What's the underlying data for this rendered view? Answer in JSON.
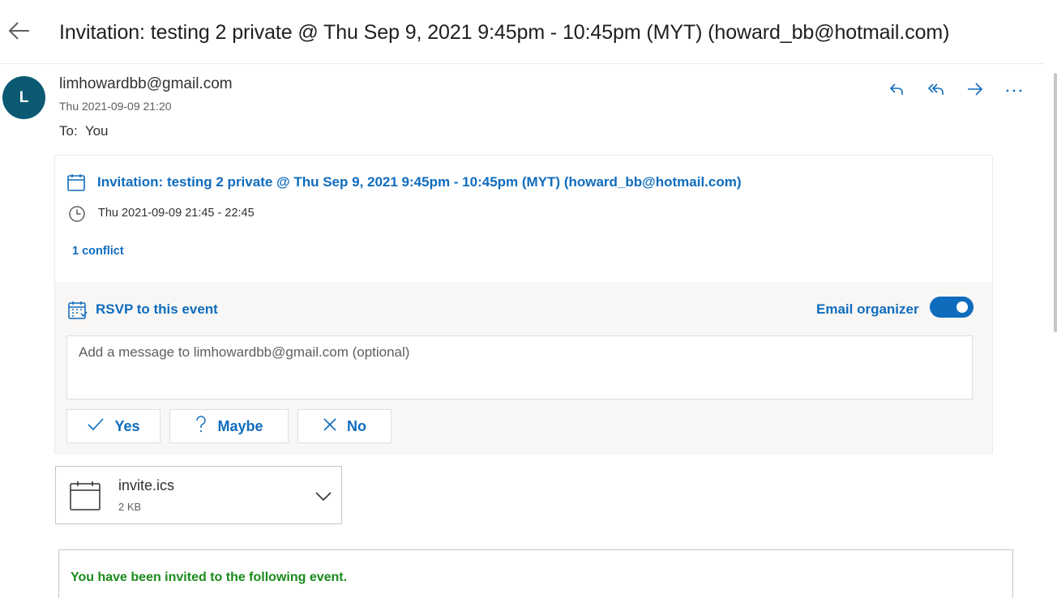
{
  "header": {
    "subject": "Invitation: testing 2 private @ Thu Sep 9, 2021 9:45pm - 10:45pm (MYT) (howard_bb@hotmail.com)"
  },
  "message": {
    "avatar_initial": "L",
    "sender": "limhowardbb@gmail.com",
    "date": "Thu 2021-09-09 21:20",
    "to_label": "To:",
    "to_value": "You"
  },
  "invite": {
    "title": "Invitation: testing 2 private @ Thu Sep 9, 2021 9:45pm - 10:45pm (MYT) (howard_bb@hotmail.com)",
    "time": "Thu 2021-09-09 21:45 - 22:45",
    "conflict": "1 conflict",
    "rsvp_label": "RSVP to this event",
    "email_organizer_label": "Email organizer",
    "email_organizer_on": true,
    "message_placeholder": "Add a message to limhowardbb@gmail.com (optional)",
    "buttons": {
      "yes": "Yes",
      "maybe": "Maybe",
      "no": "No"
    }
  },
  "attachment": {
    "name": "invite.ics",
    "size": "2 KB"
  },
  "body": {
    "invited_text": "You have been invited to the following event."
  },
  "colors": {
    "accent": "#0f6cbd",
    "avatar": "#0b5a72",
    "invited_green": "#1a8a1a"
  },
  "icons": [
    "back-arrow-icon",
    "reply-icon",
    "reply-all-icon",
    "forward-icon",
    "more-icon",
    "calendar-icon",
    "clock-icon",
    "rsvp-calendar-icon",
    "check-icon",
    "question-icon",
    "x-icon",
    "file-calendar-icon",
    "chevron-down-icon"
  ]
}
